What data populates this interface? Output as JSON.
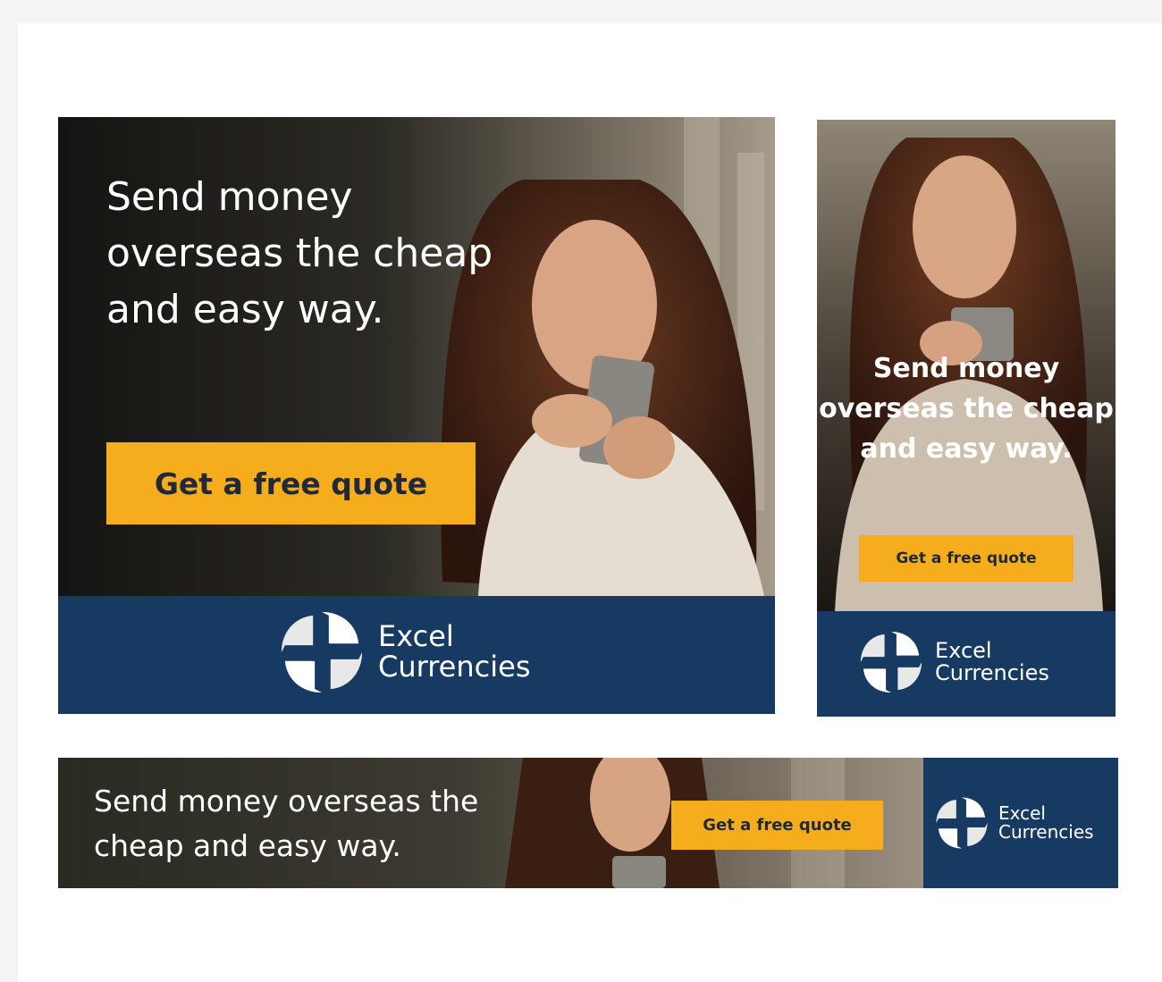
{
  "colors": {
    "navy": "#173a63",
    "cta_yellow": "#f5ac1d",
    "cta_text": "#1f2a36",
    "white": "#ffffff"
  },
  "banners": {
    "large": {
      "headline": "Send money overseas the cheap and easy way.",
      "cta_label": "Get a free quote",
      "brand_line1": "Excel",
      "brand_line2": "Currencies"
    },
    "tall": {
      "headline": "Send money overseas the cheap and easy way.",
      "cta_label": "Get a free quote",
      "brand_line1": "Excel",
      "brand_line2": "Currencies"
    },
    "wide": {
      "headline": "Send money overseas the cheap and easy way.",
      "cta_label": "Get a free quote",
      "brand_line1": "Excel",
      "brand_line2": "Currencies"
    }
  },
  "icons": {
    "logo": "excel-currencies-logo-icon",
    "photo": "woman-with-phone-photo"
  }
}
